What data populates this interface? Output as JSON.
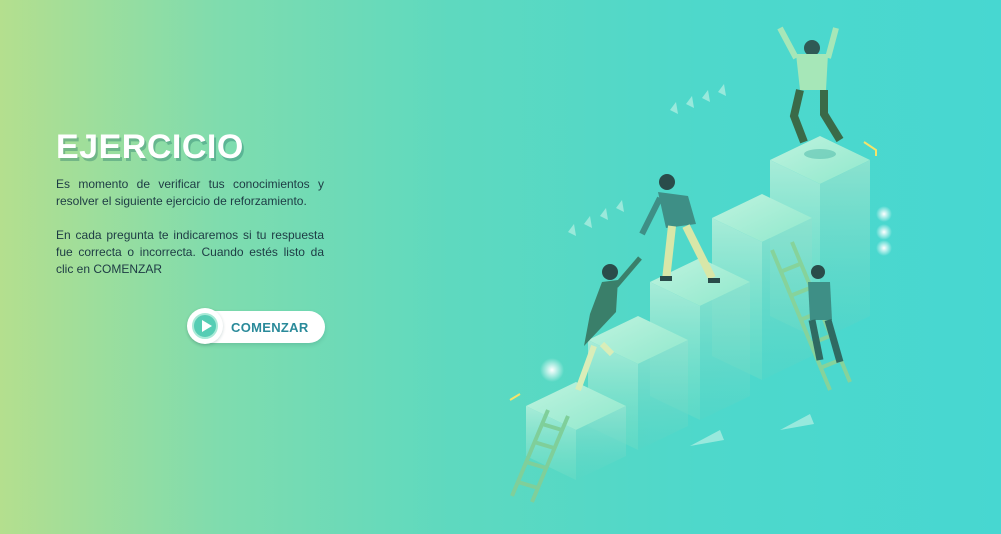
{
  "intro": {
    "title": "EJERCICIO",
    "paragraph1": "Es momento de verificar tus conocimientos y resolver el siguiente ejercicio de reforzamiento.",
    "paragraph2": "En cada pregunta te indicaremos si tu respuesta fue correcta o incorrecta. Cuando estés listo da clic en COMENZAR"
  },
  "start_button": {
    "label": "COMENZAR",
    "icon": "play-icon"
  },
  "colors": {
    "bg_left": "#b4df8e",
    "bg_right": "#47d7d1",
    "title": "#ffffff",
    "button_text": "#2a8a9a",
    "play": "#56cdb4"
  }
}
